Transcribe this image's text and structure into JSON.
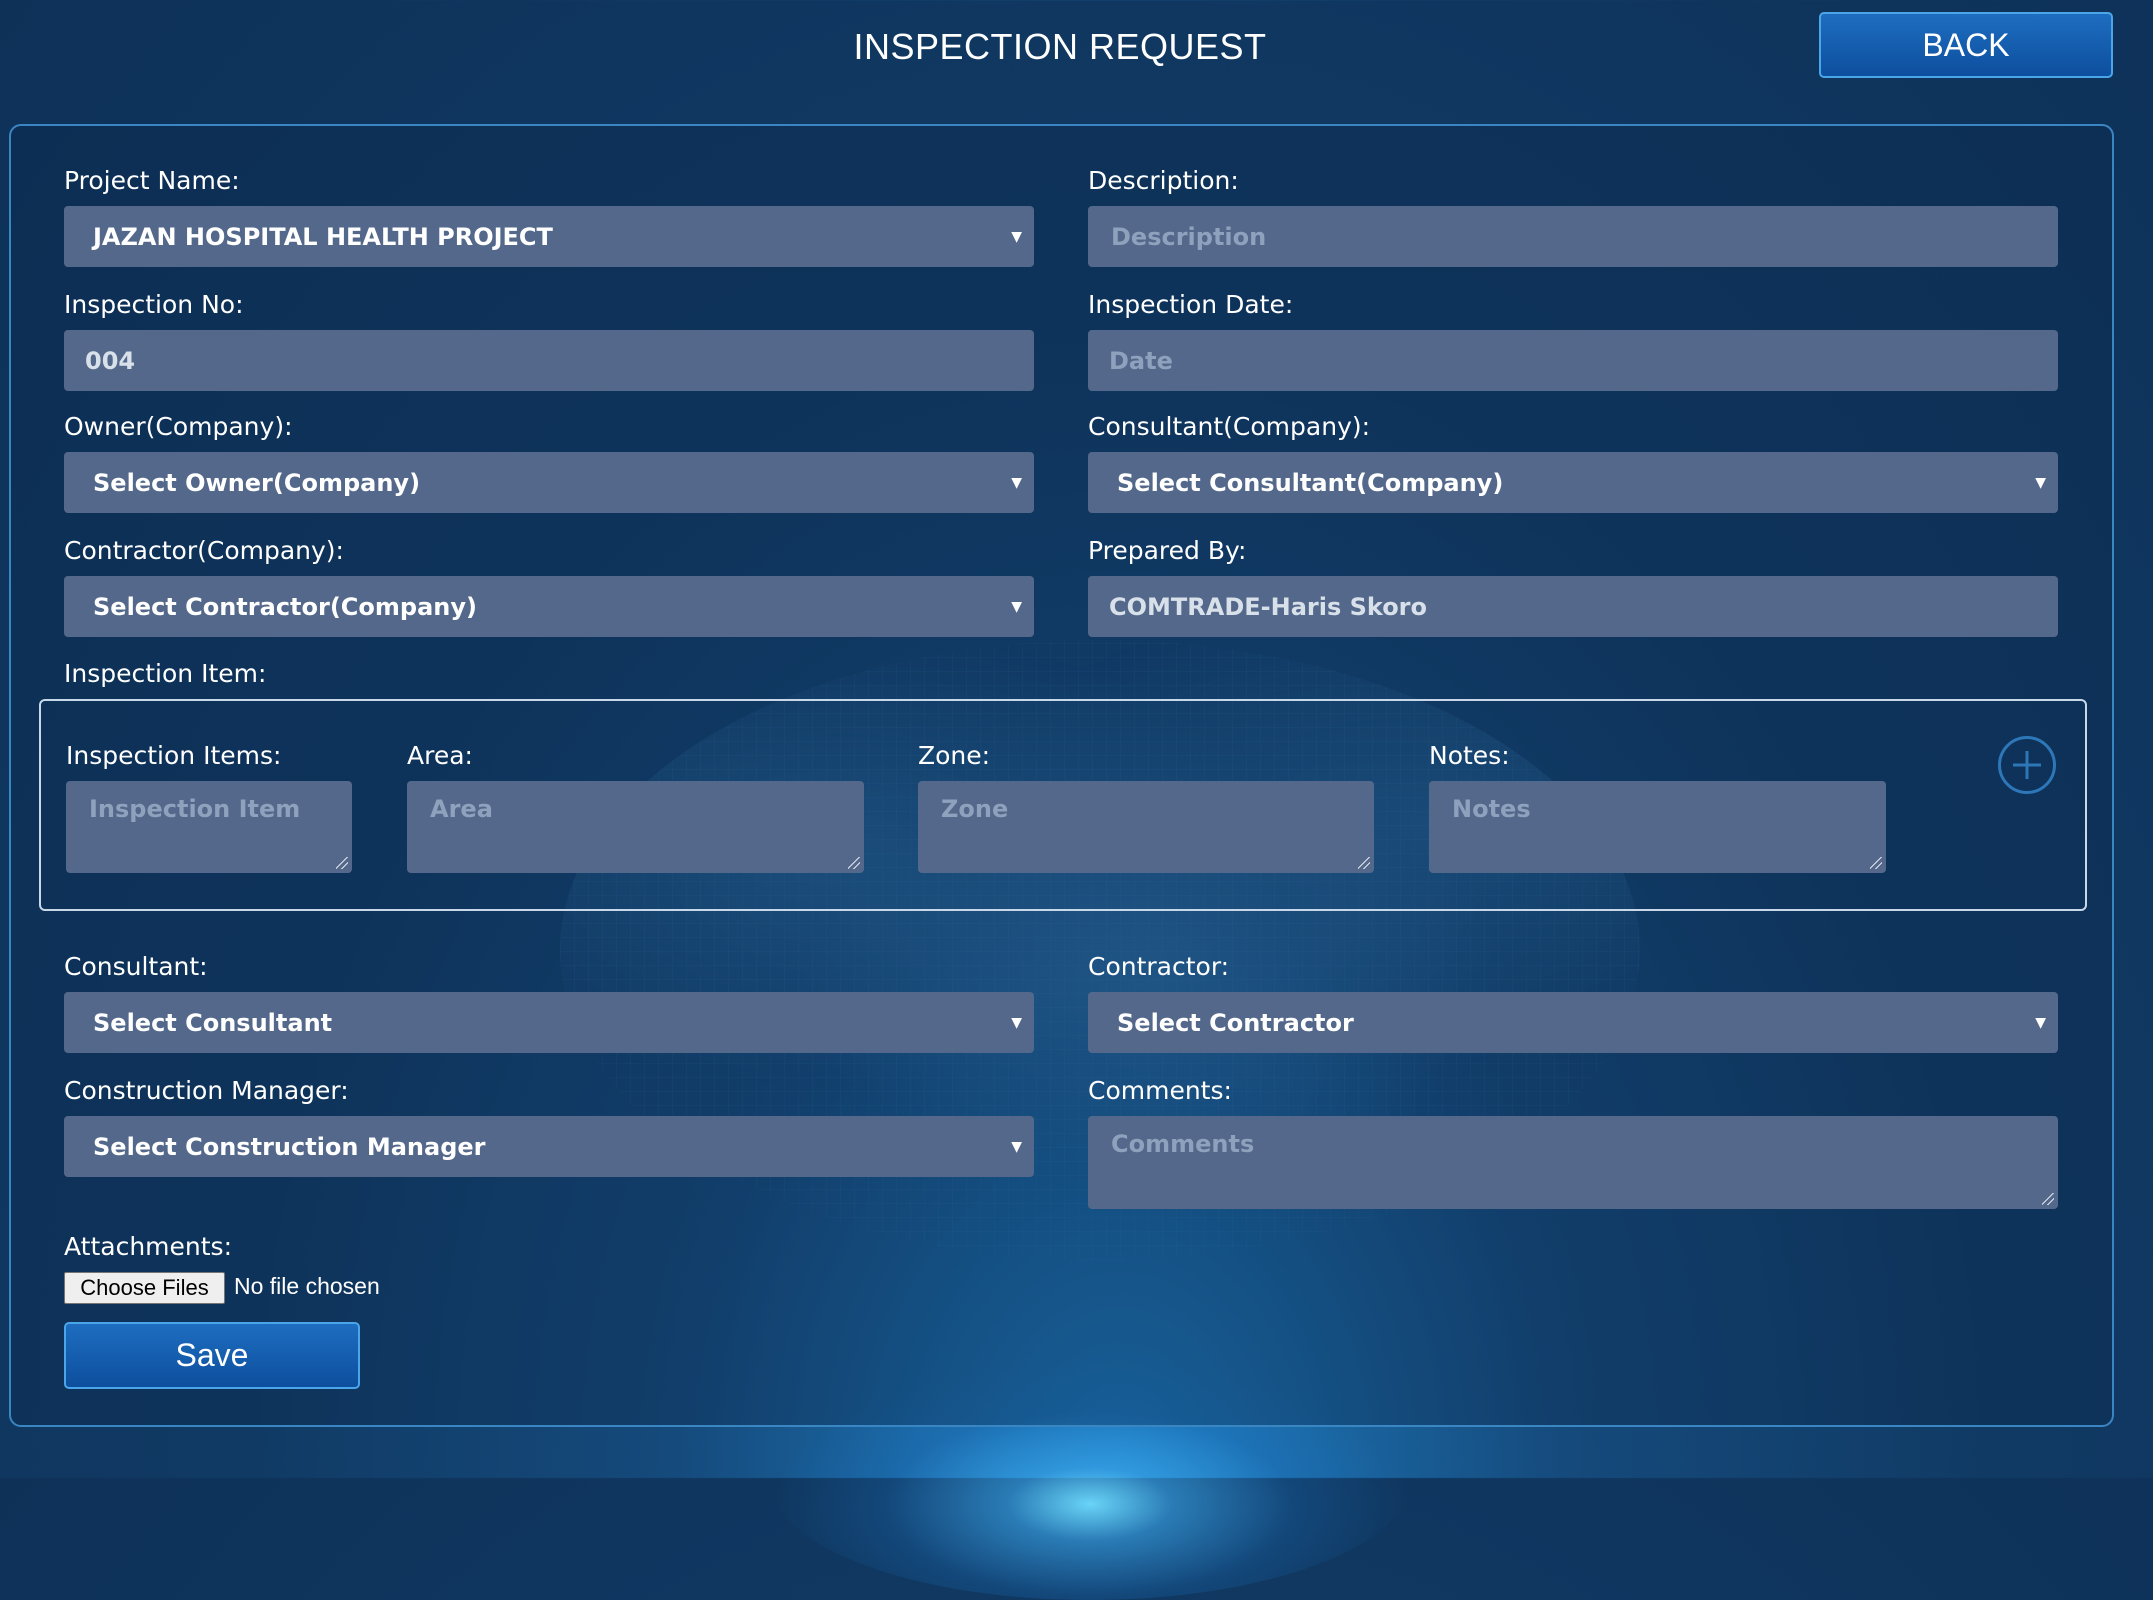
{
  "header": {
    "title": "INSPECTION REQUEST",
    "back_label": "BACK"
  },
  "form": {
    "project_name": {
      "label": "Project Name:",
      "value": "JAZAN HOSPITAL HEALTH PROJECT"
    },
    "description": {
      "label": "Description:",
      "placeholder": "Description"
    },
    "inspection_no": {
      "label": "Inspection No:",
      "value": "004"
    },
    "inspection_date": {
      "label": "Inspection Date:",
      "placeholder": "Date"
    },
    "owner_company": {
      "label": "Owner(Company):",
      "value": "Select Owner(Company)"
    },
    "consultant_company": {
      "label": "Consultant(Company):",
      "value": "Select Consultant(Company)"
    },
    "contractor_company": {
      "label": "Contractor(Company):",
      "value": "Select Contractor(Company)"
    },
    "prepared_by": {
      "label": "Prepared By:",
      "value": "COMTRADE-Haris Skoro"
    },
    "inspection_item_section": {
      "label": "Inspection Item:"
    },
    "items": {
      "inspection_items": {
        "label": "Inspection Items:",
        "placeholder": "Inspection Item"
      },
      "area": {
        "label": "Area:",
        "placeholder": "Area"
      },
      "zone": {
        "label": "Zone:",
        "placeholder": "Zone"
      },
      "notes": {
        "label": "Notes:",
        "placeholder": "Notes"
      }
    },
    "consultant": {
      "label": "Consultant:",
      "value": "Select Consultant"
    },
    "contractor": {
      "label": "Contractor:",
      "value": "Select Contractor"
    },
    "construction_manager": {
      "label": "Construction Manager:",
      "value": "Select Construction Manager"
    },
    "comments": {
      "label": "Comments:",
      "placeholder": "Comments"
    },
    "attachments": {
      "label": "Attachments:",
      "button": "Choose Files",
      "status": "No file chosen"
    },
    "save_label": "Save"
  },
  "icons": {
    "add": "plus-circle-icon",
    "dropdown": "caret-down-icon"
  },
  "colors": {
    "accent": "#1565b5",
    "field_bg": "#53688a",
    "background": "#103a64"
  }
}
